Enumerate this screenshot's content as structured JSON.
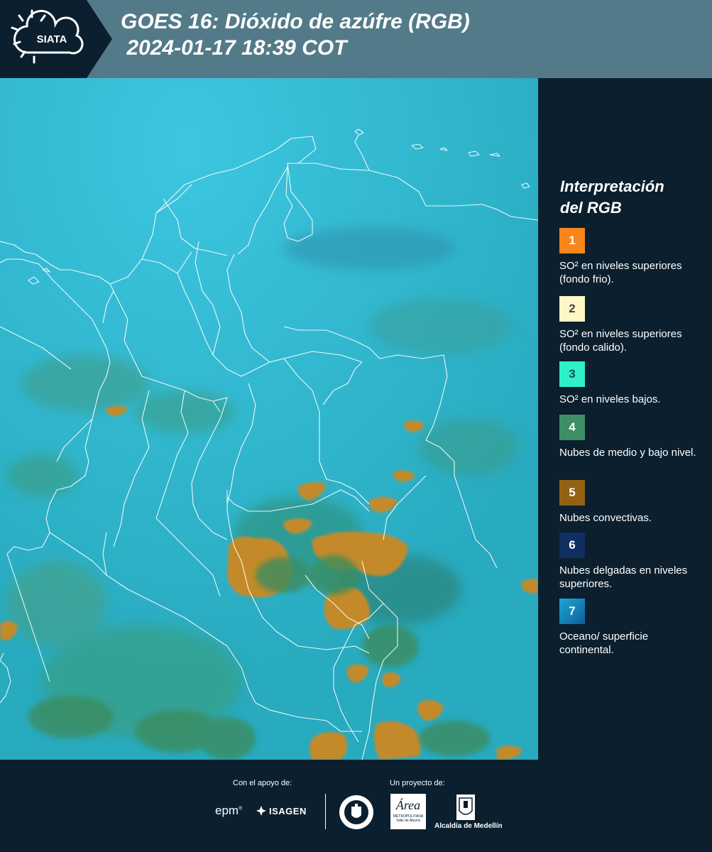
{
  "header": {
    "logo_text": "SIATA",
    "title_line1": "GOES 16: Dióxido de azúfre (RGB)",
    "title_line2": " 2024-01-17 18:39 COT"
  },
  "legend": {
    "title_line1": "Interpretación",
    "title_line2": "del RGB",
    "items": [
      {
        "number": "1",
        "label": "SO² en niveles superiores (fondo frio).",
        "color": "#f7861d",
        "text_color": "#ffffff"
      },
      {
        "number": "2",
        "label": "SO² en niveles superiores (fondo calido).",
        "color": "#fff8c6",
        "text_color": "#444444"
      },
      {
        "number": "3",
        "label": "SO² en niveles bajos.",
        "color": "#2ff0c8",
        "text_color": "#1b4a4a"
      },
      {
        "number": "4",
        "label": "Nubes de medio y bajo nivel.",
        "color": "#3f8f66",
        "text_color": "#ffffff"
      },
      {
        "number": "5",
        "label": "Nubes convectivas.",
        "color": "#946113",
        "text_color": "#ffffff"
      },
      {
        "number": "6",
        "label": "Nubes delgadas en niveles superiores.",
        "color": "#0f2f63",
        "text_color": "#ffffff"
      },
      {
        "number": "7",
        "label": "Oceano/ superficie continental.",
        "color": "#1a8fc3",
        "text_color": "#ffffff"
      }
    ]
  },
  "footer": {
    "support_label": "Con el apoyo de:",
    "project_label": "Un proyecto de:",
    "sponsor_epm": "epm",
    "sponsor_isagen": "ISAGEN",
    "area_name": "Área",
    "area_subtitle": "METROPOLITANA",
    "area_subtitle2": "Valle de Aburrá",
    "alcaldia": "Alcaldía de Medellín"
  },
  "colors": {
    "background": "#0b1f2e",
    "header_band": "#537a89",
    "map_base": "#30b6cc",
    "cloud_convective": "#c48a2c",
    "cloud_low": "#3f8f66"
  }
}
